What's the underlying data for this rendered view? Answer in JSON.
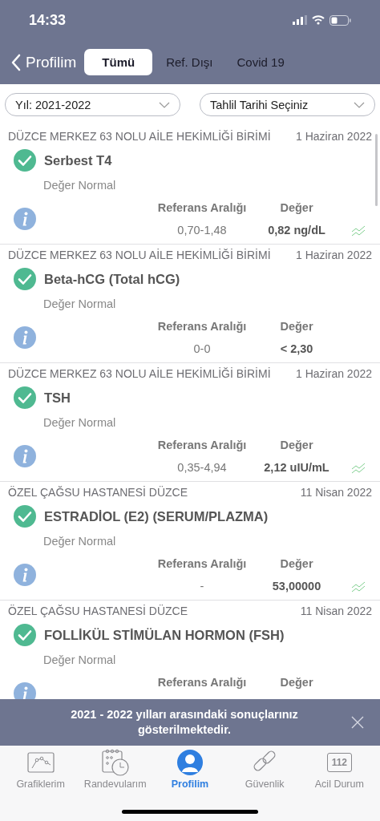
{
  "status_bar": {
    "time": "14:33"
  },
  "nav": {
    "back_label": "Profilim",
    "tabs": [
      {
        "label": "Tümü",
        "selected": true
      },
      {
        "label": "Ref. Dışı",
        "selected": false
      },
      {
        "label": "Covid 19",
        "selected": false
      }
    ]
  },
  "filters": [
    {
      "value": "Yıl: 2021-2022"
    },
    {
      "value": "Tahlil Tarihi Seçiniz"
    }
  ],
  "results": [
    {
      "institution": "DÜZCE MERKEZ 63 NOLU AİLE HEKİMLİĞİ BİRİMİ",
      "date": "1 Haziran 2022",
      "test": "Serbest T4",
      "normal": true,
      "status": "Değer Normal",
      "range_label": "Referans Aralığı",
      "value_label": "Değer",
      "range": "0,70-1,48",
      "value": "0,82 ng/dL",
      "trend": true
    },
    {
      "institution": "DÜZCE MERKEZ 63 NOLU AİLE HEKİMLİĞİ BİRİMİ",
      "date": "1 Haziran 2022",
      "test": "Beta-hCG (Total hCG)",
      "normal": true,
      "status": "Değer Normal",
      "range_label": "Referans Aralığı",
      "value_label": "Değer",
      "range": "0-0",
      "value": "< 2,30",
      "trend": false
    },
    {
      "institution": "DÜZCE MERKEZ 63 NOLU AİLE HEKİMLİĞİ BİRİMİ",
      "date": "1 Haziran 2022",
      "test": "TSH",
      "normal": true,
      "status": "Değer Normal",
      "range_label": "Referans Aralığı",
      "value_label": "Değer",
      "range": "0,35-4,94",
      "value": "2,12 uIU/mL",
      "trend": true
    },
    {
      "institution": "ÖZEL ÇAĞSU HASTANESİ DÜZCE",
      "date": "11 Nisan 2022",
      "test": "ESTRADİOL (E2) (SERUM/PLAZMA)",
      "normal": true,
      "status": "Değer Normal",
      "range_label": "Referans Aralığı",
      "value_label": "Değer",
      "range": "-",
      "value": "53,00000",
      "trend": true
    },
    {
      "institution": "ÖZEL ÇAĞSU HASTANESİ DÜZCE",
      "date": "11 Nisan 2022",
      "test": "FOLLİKÜL STİMÜLAN HORMON (FSH)",
      "normal": true,
      "status": "Değer Normal",
      "range_label": "Referans Aralığı",
      "value_label": "Değer",
      "trend": false
    }
  ],
  "banner": {
    "message": "2021 - 2022 yılları arasındaki sonuçlarınız gösterilmektedir."
  },
  "tab_bar": [
    {
      "label": "Grafiklerim",
      "kind": "chart",
      "selected": false
    },
    {
      "label": "Randevularım",
      "kind": "calendar",
      "selected": false
    },
    {
      "label": "Profilim",
      "kind": "profile",
      "selected": true
    },
    {
      "label": "Güvenlik",
      "kind": "link",
      "selected": false
    },
    {
      "label": "Acil Durum",
      "kind": "emergency",
      "badge": "112",
      "selected": false
    }
  ]
}
